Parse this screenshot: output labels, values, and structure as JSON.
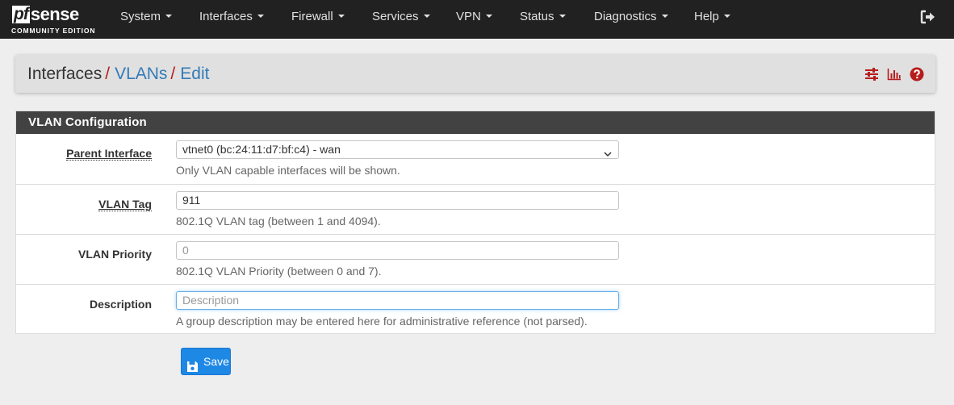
{
  "logo": {
    "pf": "pf",
    "sense": "sense",
    "edition": "COMMUNITY EDITION"
  },
  "nav": {
    "items": [
      {
        "label": "System"
      },
      {
        "label": "Interfaces"
      },
      {
        "label": "Firewall"
      },
      {
        "label": "Services"
      },
      {
        "label": "VPN"
      },
      {
        "label": "Status"
      },
      {
        "label": "Diagnostics"
      },
      {
        "label": "Help"
      }
    ],
    "logout_icon": "logout-icon"
  },
  "breadcrumb": {
    "root": "Interfaces",
    "sep1": "/",
    "vlans": "VLANs",
    "sep2": "/",
    "edit": "Edit",
    "icons": [
      "sliders-icon",
      "bar-chart-icon",
      "question-circle-icon"
    ]
  },
  "panel": {
    "title": "VLAN Configuration",
    "parent_interface": {
      "label": "Parent Interface",
      "value": "vtnet0 (bc:24:11:d7:bf:c4) - wan",
      "help": "Only VLAN capable interfaces will be shown."
    },
    "vlan_tag": {
      "label": "VLAN Tag",
      "value": "911",
      "help": "802.1Q VLAN tag (between 1 and 4094)."
    },
    "vlan_priority": {
      "label": "VLAN Priority",
      "placeholder": "0",
      "help": "802.1Q VLAN Priority (between 0 and 7)."
    },
    "description": {
      "label": "Description",
      "placeholder": "Description",
      "help": "A group description may be entered here for administrative reference (not parsed)."
    }
  },
  "save": {
    "label": "Save"
  },
  "colors": {
    "navbar": "#212121",
    "accent_red": "#b71c1c",
    "link_blue": "#337ab7",
    "button_blue": "#1e88e5",
    "panel_heading": "#424242"
  }
}
